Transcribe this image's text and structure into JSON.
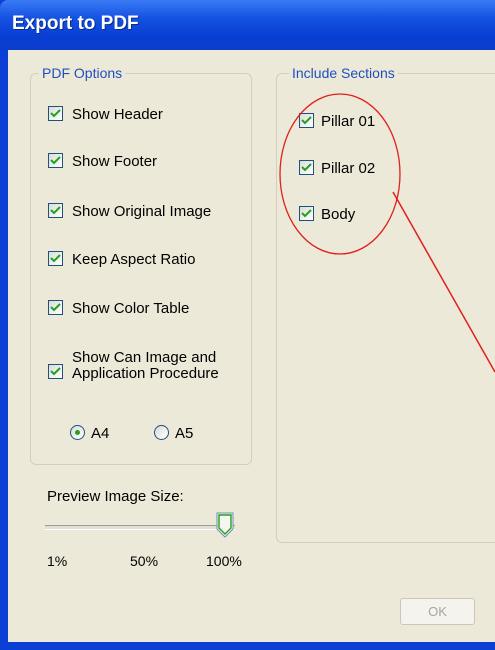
{
  "window": {
    "title": "Export to PDF"
  },
  "pdf_options": {
    "legend": "PDF Options",
    "items": [
      {
        "label": "Show Header",
        "checked": true
      },
      {
        "label": "Show Footer",
        "checked": true
      },
      {
        "label": "Show Original Image",
        "checked": true
      },
      {
        "label": "Keep Aspect Ratio",
        "checked": true
      },
      {
        "label": "Show Color Table",
        "checked": true
      },
      {
        "label": "Show Can Image and\nApplication Procedure",
        "checked": true
      }
    ],
    "paper_size": {
      "options": [
        "A4",
        "A5"
      ],
      "selected": "A4"
    }
  },
  "preview": {
    "label": "Preview Image Size:",
    "ticks": [
      "1%",
      "50%",
      "100%"
    ],
    "value_percent": 100
  },
  "include_sections": {
    "legend": "Include Sections",
    "items": [
      {
        "label": "Pillar 01",
        "checked": true
      },
      {
        "label": "Pillar 02",
        "checked": true
      },
      {
        "label": "Body",
        "checked": true
      }
    ]
  },
  "buttons": {
    "ok": "OK",
    "ok_enabled": false
  },
  "colors": {
    "titlebar": "#0b3fd6",
    "dialog_bg": "#ece9d8",
    "check": "#21a121",
    "annotation": "#e0201c"
  }
}
